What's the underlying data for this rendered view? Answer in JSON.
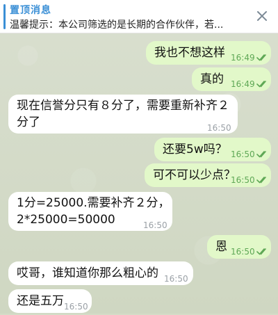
{
  "pinned": {
    "title": "置顶消息",
    "text": "温馨提示：本公司筛选的是长期的合作伙伴，若..."
  },
  "messages": [
    {
      "dir": "out",
      "text": "我也不想这样",
      "time": "16:49"
    },
    {
      "dir": "out",
      "text": "真的",
      "time": "16:49"
    },
    {
      "dir": "in",
      "text_line1": "现在信誉分只有８分了，需要重新补齐２",
      "text_line2": "分了",
      "time": "16:50"
    },
    {
      "dir": "out",
      "text": "还要5w吗？",
      "time": "16:50"
    },
    {
      "dir": "out",
      "text": "可不可以少点？",
      "time": "16:50"
    },
    {
      "dir": "in",
      "text_line1": "1分=25000.需要补齐２分，",
      "text_line2": "2*25000=50000",
      "time": "16:50"
    },
    {
      "dir": "out",
      "text": "恩",
      "time": "16:50"
    },
    {
      "dir": "in",
      "text": "哎哥，谁知道你那么粗心的",
      "time": "16:50"
    },
    {
      "dir": "in",
      "text": "还是五万",
      "time": "16:50"
    }
  ],
  "colors": {
    "accent": "#3a8fd6",
    "outgoing_bubble": "#e2f8c9",
    "read_check": "#5fa856"
  }
}
